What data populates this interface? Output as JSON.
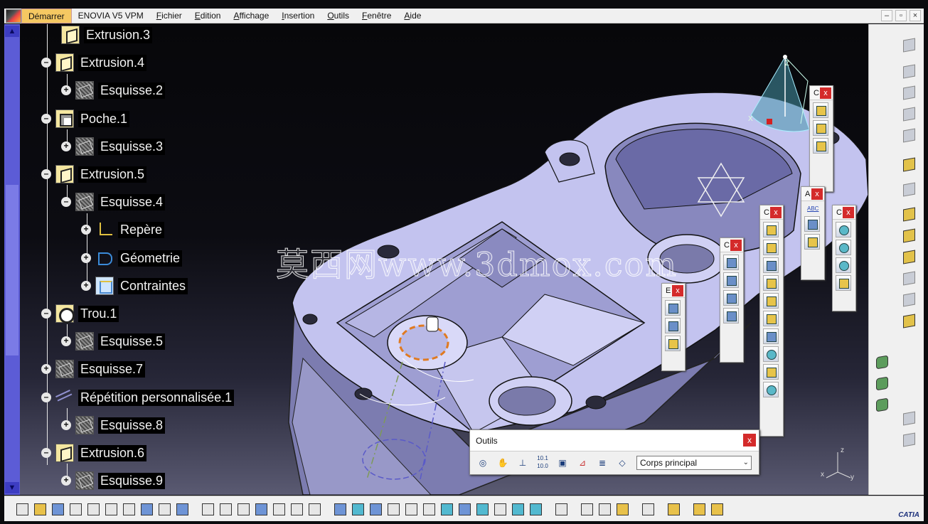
{
  "menubar": {
    "start": "Démarrer",
    "items": [
      "ENOVIA V5 VPM",
      "Fichier",
      "Edition",
      "Affichage",
      "Insertion",
      "Outils",
      "Fenêtre",
      "Aide"
    ]
  },
  "window_buttons": {
    "minimize": "–",
    "restore": "▫",
    "close": "×"
  },
  "tree": {
    "nodes": [
      {
        "label": "Extrusion.3",
        "icon": "pad-icon"
      },
      {
        "label": "Extrusion.4",
        "icon": "pad-icon"
      },
      {
        "label": "Esquisse.2",
        "icon": "sketch-icon"
      },
      {
        "label": "Poche.1",
        "icon": "pocket-icon"
      },
      {
        "label": "Esquisse.3",
        "icon": "sketch-icon"
      },
      {
        "label": "Extrusion.5",
        "icon": "pad-icon"
      },
      {
        "label": "Esquisse.4",
        "icon": "sketch-icon"
      },
      {
        "label": "Repère",
        "icon": "axis-icon"
      },
      {
        "label": "Géometrie",
        "icon": "geometry-icon"
      },
      {
        "label": "Contraintes",
        "icon": "constraint-icon"
      },
      {
        "label": "Trou.1",
        "icon": "hole-icon"
      },
      {
        "label": "Esquisse.5",
        "icon": "sketch-icon"
      },
      {
        "label": "Esquisse.7",
        "icon": "sketch-icon"
      },
      {
        "label": "Répétition personnalisée.1",
        "icon": "pattern-icon"
      },
      {
        "label": "Esquisse.8",
        "icon": "sketch-icon"
      },
      {
        "label": "Extrusion.6",
        "icon": "pad-icon"
      },
      {
        "label": "Esquisse.9",
        "icon": "sketch-icon"
      }
    ]
  },
  "watermark": "莫西网www.3dmox.com",
  "compass": {
    "x": "X",
    "z": "Z"
  },
  "axis_triad": {
    "x": "x",
    "y": "y",
    "z": "z"
  },
  "floating_toolbars": {
    "t1": {
      "title": "C",
      "close": "x"
    },
    "t2": {
      "title": "A",
      "close": "x"
    },
    "t3": {
      "title": "C",
      "close": "x"
    },
    "t4": {
      "title": "C",
      "close": "x"
    },
    "t5": {
      "title": "C",
      "close": "x"
    },
    "t6": {
      "title": "E",
      "close": "x"
    },
    "abc_label": "ABC"
  },
  "outils": {
    "title": "Outils",
    "close": "x",
    "select_value": "Corps principal",
    "scale_label": "10.1 10.0"
  },
  "logo": "CATIA",
  "colors": {
    "part_face": "#c3c3ef",
    "part_shadow": "#8c8cc2",
    "menu_start": "#f5c862",
    "close_red": "#d42b2b",
    "scrollbar": "#5c5cd6"
  }
}
